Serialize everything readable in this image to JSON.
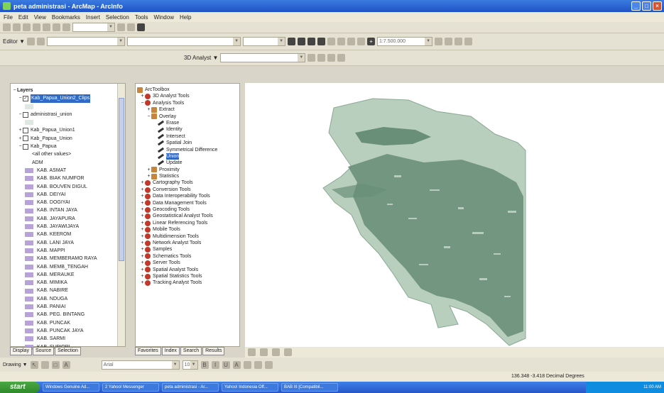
{
  "window": {
    "title": "peta administrasi - ArcMap - ArcInfo"
  },
  "menu": [
    "File",
    "Edit",
    "View",
    "Bookmarks",
    "Insert",
    "Selection",
    "Tools",
    "Window",
    "Help"
  ],
  "toolbar": {
    "editor_label": "Editor ▼",
    "scale": "1:7.500.000",
    "analyst_label": "3D Analyst ▼"
  },
  "toc": {
    "root": "Layers",
    "layers": [
      {
        "label": "Kab_Papua_Union2_Clips",
        "checked": true,
        "selected": true
      },
      {
        "label": "administrasi_union",
        "checked": false
      },
      {
        "label": "Kab_Papua_Union1",
        "checked": false
      },
      {
        "label": "Kab_Papua_Union",
        "checked": false
      },
      {
        "label": "Kab_Papua",
        "checked": false
      }
    ],
    "legend_header": "<all other values>",
    "legend_field": "ADM",
    "legend_items": [
      "KAB. ASMAT",
      "KAB. BIAK NUMFOR",
      "KAB. BOUVEN DIGUL",
      "KAB. DEIYAI",
      "KAB. DOGIYAI",
      "KAB. INTAN JAYA",
      "KAB. JAYAPURA",
      "KAB. JAYAWIJAYA",
      "KAB. KEEROM",
      "KAB. LANI JAYA",
      "KAB. MAPPI",
      "KAB. MEMBERAMO RAYA",
      "KAB. MEMB_TENGAH",
      "KAB. MERAUKE",
      "KAB. MIMIKA",
      "KAB. NABIRE",
      "KAB. NDUGA",
      "KAB. PANIAI",
      "KAB. PEG. BINTANG",
      "KAB. PUNCAK",
      "KAB. PUNCAK JAYA",
      "KAB. SARMI",
      "KAB. SUPIORI"
    ],
    "tabs": [
      "Display",
      "Source",
      "Selection"
    ]
  },
  "toolbox": {
    "root": "ArcToolbox",
    "items": [
      {
        "label": "3D Analyst Tools",
        "level": 1,
        "kind": "tb"
      },
      {
        "label": "Analysis Tools",
        "level": 1,
        "kind": "tb",
        "open": true
      },
      {
        "label": "Extract",
        "level": 2,
        "kind": "box"
      },
      {
        "label": "Overlay",
        "level": 2,
        "kind": "box",
        "open": true
      },
      {
        "label": "Erase",
        "level": 3,
        "kind": "tool"
      },
      {
        "label": "Identity",
        "level": 3,
        "kind": "tool"
      },
      {
        "label": "Intersect",
        "level": 3,
        "kind": "tool"
      },
      {
        "label": "Spatial Join",
        "level": 3,
        "kind": "tool"
      },
      {
        "label": "Symmetrical Difference",
        "level": 3,
        "kind": "tool"
      },
      {
        "label": "Union",
        "level": 3,
        "kind": "tool",
        "selected": true
      },
      {
        "label": "Update",
        "level": 3,
        "kind": "tool"
      },
      {
        "label": "Proximity",
        "level": 2,
        "kind": "box"
      },
      {
        "label": "Statistics",
        "level": 2,
        "kind": "box"
      },
      {
        "label": "Cartography Tools",
        "level": 1,
        "kind": "tb"
      },
      {
        "label": "Conversion Tools",
        "level": 1,
        "kind": "tb"
      },
      {
        "label": "Data Interoperability Tools",
        "level": 1,
        "kind": "tb"
      },
      {
        "label": "Data Management Tools",
        "level": 1,
        "kind": "tb"
      },
      {
        "label": "Geocoding Tools",
        "level": 1,
        "kind": "tb"
      },
      {
        "label": "Geostatistical Analyst Tools",
        "level": 1,
        "kind": "tb"
      },
      {
        "label": "Linear Referencing Tools",
        "level": 1,
        "kind": "tb"
      },
      {
        "label": "Mobile Tools",
        "level": 1,
        "kind": "tb"
      },
      {
        "label": "Multidimension Tools",
        "level": 1,
        "kind": "tb"
      },
      {
        "label": "Network Analyst Tools",
        "level": 1,
        "kind": "tb"
      },
      {
        "label": "Samples",
        "level": 1,
        "kind": "tb"
      },
      {
        "label": "Schematics Tools",
        "level": 1,
        "kind": "tb"
      },
      {
        "label": "Server Tools",
        "level": 1,
        "kind": "tb"
      },
      {
        "label": "Spatial Analyst Tools",
        "level": 1,
        "kind": "tb"
      },
      {
        "label": "Spatial Statistics Tools",
        "level": 1,
        "kind": "tb"
      },
      {
        "label": "Tracking Analyst Tools",
        "level": 1,
        "kind": "tb"
      }
    ],
    "tabs": [
      "Favorites",
      "Index",
      "Search",
      "Results"
    ]
  },
  "drawing": {
    "label": "Drawing ▼",
    "font": "Arial",
    "size": "10"
  },
  "status": {
    "coords": "136.348  -3.418 Decimal Degrees"
  },
  "taskbar": {
    "start": "start",
    "tasks": [
      "Windows Genuine Ad...",
      "2 Yahoo! Messenger",
      "peta administrasi - Ar...",
      "Yahoo! Indonesia Off...",
      "BAB III [Compatibil..."
    ],
    "clock": "11:00 AM"
  },
  "colors": {
    "map_fill": "#b9cfbd",
    "map_dense": "#6a8f78",
    "legend_swatch": "#b8a3d9",
    "selection": "#316ac5"
  }
}
